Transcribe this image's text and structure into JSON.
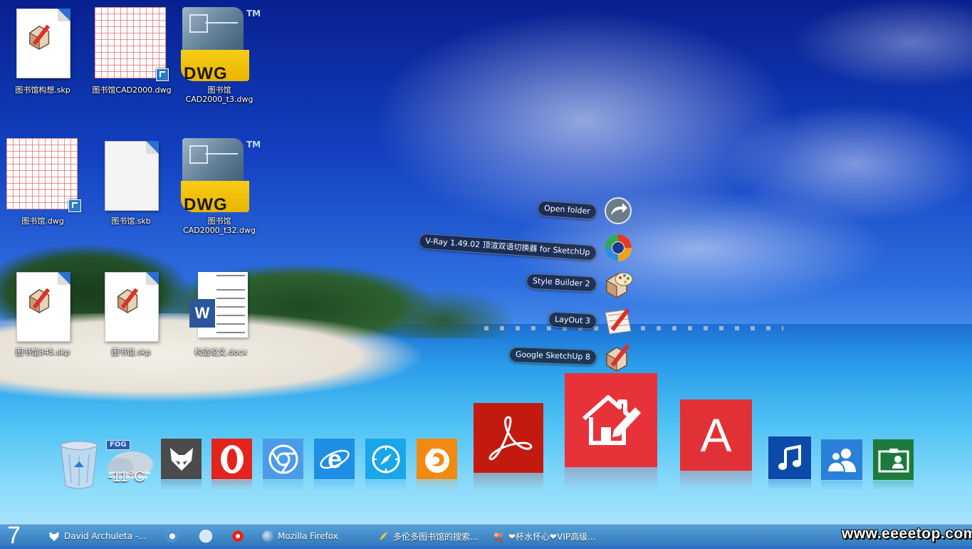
{
  "desktop": {
    "icons": [
      {
        "label": "图书馆构想.skp"
      },
      {
        "label": "图书馆CAD2000.dwg"
      },
      {
        "label": "图书馆\nCAD2000_t3.dwg"
      },
      {
        "label": "图书馆.dwg"
      },
      {
        "label": "图书馆.skb"
      },
      {
        "label": "图书馆\nCAD2000_t32.dwg"
      },
      {
        "label": "图书馆345.skp"
      },
      {
        "label": "图书馆.skp"
      },
      {
        "label": "构造论文.docx"
      }
    ],
    "dwg_badge": "DWG",
    "tm_mark": "TM",
    "word_letter": "W"
  },
  "jumplist": {
    "items": [
      {
        "label": "Open folder",
        "icon": "open-folder-arrow-icon"
      },
      {
        "label": "V-Ray 1.49.02 顶渲双语切换器 for SketchUp",
        "icon": "vray-icon"
      },
      {
        "label": "Style Builder 2",
        "icon": "style-builder-icon"
      },
      {
        "label": "LayOut 3",
        "icon": "layout-icon"
      },
      {
        "label": "Google SketchUp 8",
        "icon": "sketchup-icon"
      }
    ]
  },
  "dock": {
    "weather": {
      "badge": "FOG",
      "temp": "-11°C"
    },
    "items": [
      {
        "name": "recycle-bin",
        "color": "#9fb9d8"
      },
      {
        "name": "weather-widget",
        "color": "#9fb3c6"
      },
      {
        "name": "foobar",
        "color": "#555555"
      },
      {
        "name": "opera",
        "color": "#e0201a"
      },
      {
        "name": "chrome",
        "color": "#3b8ee0"
      },
      {
        "name": "internet-explorer",
        "color": "#1a8ae0"
      },
      {
        "name": "safari",
        "color": "#1aa2e8"
      },
      {
        "name": "firefox",
        "color": "#f08a10"
      },
      {
        "name": "adobe-reader",
        "color": "#c4170d"
      },
      {
        "name": "sketchup-home",
        "color": "#e8323a"
      },
      {
        "name": "autocad",
        "color": "#e23136"
      },
      {
        "name": "music",
        "color": "#0a4aa8"
      },
      {
        "name": "contacts",
        "color": "#2a7fd8"
      },
      {
        "name": "photo-card",
        "color": "#1f7a3c"
      }
    ],
    "autocad_letter": "A"
  },
  "taskbar": {
    "start_label": "7",
    "items": [
      {
        "label": "David Archuleta -..."
      },
      {
        "label": ""
      },
      {
        "label": ""
      },
      {
        "label": ""
      },
      {
        "label": "Mozilla Firefox"
      },
      {
        "label": "多伦多图书馆的搜索..."
      },
      {
        "label": "❤杯水怀心❤VIP高级..."
      }
    ]
  },
  "watermark": "www.eeeetop.com"
}
